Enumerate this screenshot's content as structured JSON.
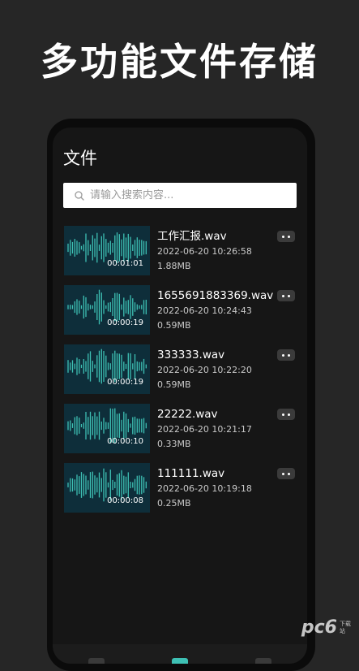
{
  "banner": {
    "headline": "多功能文件存储"
  },
  "screen": {
    "title": "文件",
    "search": {
      "placeholder": "请输入搜索内容...",
      "value": ""
    },
    "files": [
      {
        "name": "工作汇报.wav",
        "date": "2022-06-20 10:26:58",
        "size": "1.88MB",
        "duration": "00:01:01"
      },
      {
        "name": "1655691883369.wav",
        "date": "2022-06-20 10:24:43",
        "size": "0.59MB",
        "duration": "00:00:19"
      },
      {
        "name": "333333.wav",
        "date": "2022-06-20 10:22:20",
        "size": "0.59MB",
        "duration": "00:00:19"
      },
      {
        "name": "22222.wav",
        "date": "2022-06-20 10:21:17",
        "size": "0.33MB",
        "duration": "00:00:10"
      },
      {
        "name": "111111.wav",
        "date": "2022-06-20 10:19:18",
        "size": "0.25MB",
        "duration": "00:00:08"
      }
    ],
    "item_menu_icon": "more-dots-icon",
    "search_icon": "search-icon"
  },
  "watermark": {
    "logo": "pc6",
    "text": "下载站"
  },
  "colors": {
    "background": "#262626",
    "phone_screen": "#161616",
    "waveform": "#3ec0b4",
    "thumbnail_bg": "#0e2e3a",
    "tab_active": "#3ec0b4"
  }
}
